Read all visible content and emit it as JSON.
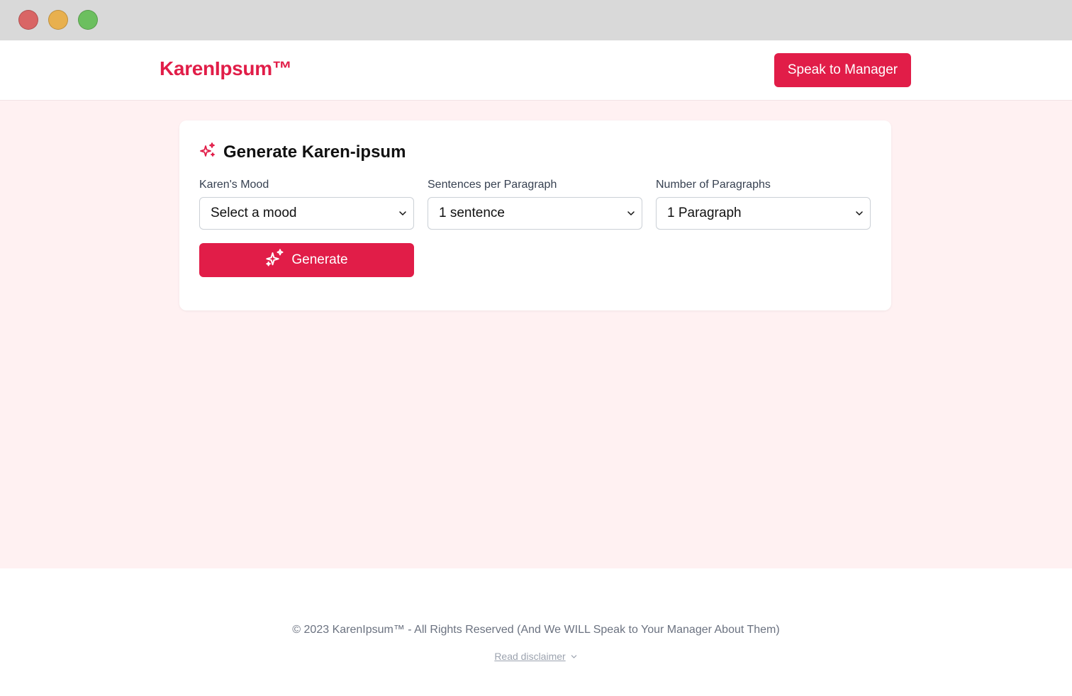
{
  "colors": {
    "accent": "#e11d48",
    "background_tint": "#fff1f2",
    "chrome": "#d9d9d9"
  },
  "header": {
    "brand": "KarenIpsum™",
    "manager_button": "Speak to Manager"
  },
  "card": {
    "title": "Generate Karen-ipsum",
    "title_icon": "sparkles-icon",
    "fields": {
      "mood": {
        "label": "Karen's Mood",
        "value": "Select a mood"
      },
      "sentences": {
        "label": "Sentences per Paragraph",
        "value": "1 sentence"
      },
      "paragraphs": {
        "label": "Number of Paragraphs",
        "value": "1 Paragraph"
      }
    },
    "generate_button": "Generate",
    "generate_icon": "sparkles-icon"
  },
  "footer": {
    "copyright": "© 2023 KarenIpsum™ - All Rights Reserved (And We WILL Speak to Your Manager About Them)",
    "disclaimer_link": "Read disclaimer",
    "disclaimer_icon": "chevron-down-icon"
  }
}
